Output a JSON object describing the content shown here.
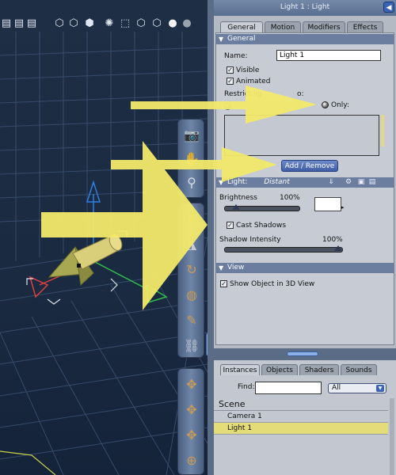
{
  "viewport": {
    "toolbar_icons": [
      "render-mode-icon",
      "render-mode-icon",
      "render-mode-icon",
      "wireframe-icon",
      "hidden-line-icon",
      "lit-wireframe-icon",
      "box-icon",
      "smooth-shaded-icon",
      "texture-shaded-icon"
    ]
  },
  "tools": {
    "camera_controls": [
      "camera-icon",
      "hand-pan-icon",
      "zoom-icon"
    ],
    "editing_tools": [
      "rotate-tool-icon",
      "translate-tool-icon",
      "twist-tool-icon",
      "scale-tool-icon",
      "taper-tool-icon",
      "chain-break-tool-icon"
    ],
    "movement": [
      "move-icon",
      "move-xz-icon",
      "move-xy-icon",
      "ball-icon"
    ]
  },
  "props": {
    "title": "Light 1 : Light",
    "tabs": [
      "General",
      "Motion",
      "Modifiers",
      "Effects"
    ],
    "active_tab": "General",
    "general": {
      "section_title": "General",
      "name_label": "Name:",
      "name_value": "Light 1",
      "visible_label": "Visible",
      "visible_checked": true,
      "animated_label": "Animated",
      "animated_checked": true,
      "restrict_label_visible": "Restrict lig",
      "restrict_label_tail": "o:",
      "only_label": "Only:",
      "add_remove_label": "Add / Remove"
    },
    "light": {
      "section_label": "Light:",
      "type_value": "Distant",
      "brightness_label": "Brightness",
      "brightness_value": "100%",
      "brightness_level": 0.15,
      "color": "#ffffff",
      "cast_shadows_label": "Cast Shadows",
      "cast_shadows_checked": true,
      "shadow_intensity_label": "Shadow Intensity",
      "shadow_intensity_value": "100%",
      "shadow_intensity_level": 1.0
    },
    "view": {
      "section_title": "View",
      "show_object_label": "Show Object in 3D View",
      "show_object_checked": true
    }
  },
  "scene": {
    "tabs": [
      "Instances",
      "Objects",
      "Shaders",
      "Sounds"
    ],
    "active_tab": "Instances",
    "find_label": "Find:",
    "find_value": "",
    "filter_value": "All",
    "header": "Scene",
    "rows": [
      "Camera 1",
      "Light 1"
    ],
    "selected": "Light 1"
  },
  "colors": {
    "annotation_arrow": "#f2e96a",
    "selected_row": "#e4dc78",
    "section_bar": "#6b7ea0"
  }
}
